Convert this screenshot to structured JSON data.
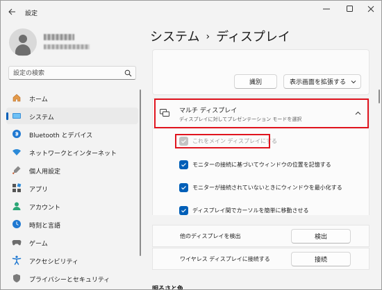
{
  "window": {
    "title": "設定"
  },
  "search": {
    "placeholder": "設定の検索"
  },
  "sidebar": {
    "items": [
      {
        "label": "ホーム",
        "icon": "home-icon"
      },
      {
        "label": "システム",
        "icon": "system-icon",
        "active": true
      },
      {
        "label": "Bluetooth とデバイス",
        "icon": "bluetooth-icon"
      },
      {
        "label": "ネットワークとインターネット",
        "icon": "network-icon"
      },
      {
        "label": "個人用設定",
        "icon": "personalization-icon"
      },
      {
        "label": "アプリ",
        "icon": "apps-icon"
      },
      {
        "label": "アカウント",
        "icon": "account-icon"
      },
      {
        "label": "時刻と言語",
        "icon": "time-language-icon"
      },
      {
        "label": "ゲーム",
        "icon": "gaming-icon"
      },
      {
        "label": "アクセシビリティ",
        "icon": "accessibility-icon"
      },
      {
        "label": "プライバシーとセキュリティ",
        "icon": "privacy-icon"
      }
    ]
  },
  "breadcrumb": {
    "parent": "システム",
    "separator": "›",
    "current": "ディスプレイ"
  },
  "display_card": {
    "identify_label": "識別",
    "mode_value": "表示画面を拡張する"
  },
  "multi_display": {
    "title": "マルチ ディスプレイ",
    "subtitle": "ディスプレイに対してプレゼンテーション モードを選択",
    "checkboxes": [
      {
        "label": "これをメイン ディスプレイにする",
        "checked": true,
        "disabled": true
      },
      {
        "label": "モニターの接続に基づいてウィンドウの位置を記憶する",
        "checked": true,
        "disabled": false
      },
      {
        "label": "モニターが接続されていないときにウィンドウを最小化する",
        "checked": true,
        "disabled": false
      },
      {
        "label": "ディスプレイ間でカーソルを簡単に移動させる",
        "checked": true,
        "disabled": false
      }
    ],
    "detect_label": "他のディスプレイを検出",
    "detect_button": "検出",
    "wireless_label": "ワイヤレス ディスプレイに接続する",
    "wireless_button": "接続"
  },
  "next_section": {
    "title": "明るさと色"
  },
  "colors": {
    "accent": "#005fb8",
    "highlight": "#e0141e"
  }
}
